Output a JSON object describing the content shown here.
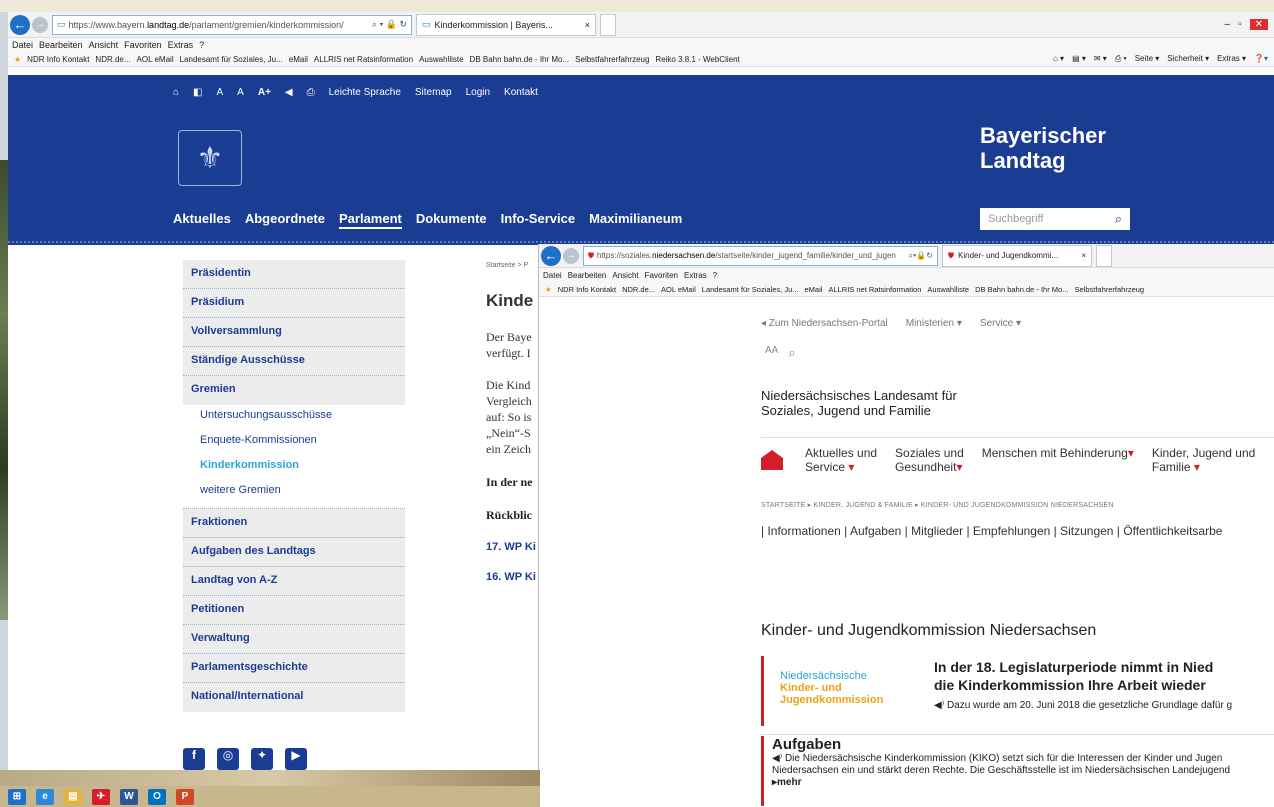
{
  "w1": {
    "url_prefix": "https://www.bayern.",
    "url_domain": "landtag.de",
    "url_path": "/parlament/gremien/kinderkommission/",
    "tab_title": "Kinderkommission | Bayeris...",
    "menu": [
      "Datei",
      "Bearbeiten",
      "Ansicht",
      "Favoriten",
      "Extras",
      "?"
    ],
    "favorites": [
      "NDR Info Kontakt",
      "NDR.de...",
      "AOL eMail",
      "Landesamt für Soziales, Ju...",
      "eMail",
      "ALLRIS net Ratsinformation",
      "Auswahlliste",
      "DB Bahn bahn.de - Ihr Mo...",
      "Selbstfahrerfahrzeug",
      "Reiko 3.8.1 - WebClient"
    ],
    "cmdbar": [
      "Seite ▾",
      "Sicherheit ▾",
      "Extras ▾"
    ],
    "util_nav": [
      "A",
      "A",
      "A+",
      "Leichte Sprache",
      "Sitemap",
      "Login",
      "Kontakt"
    ],
    "logo_line1": "Bayerischer",
    "logo_line2": "Landtag",
    "main_nav": [
      "Aktuelles",
      "Abgeordnete",
      "Parlament",
      "Dokumente",
      "Info-Service",
      "Maximilianeum"
    ],
    "search_placeholder": "Suchbegriff",
    "sidebar": {
      "items_top": [
        "Präsidentin",
        "Präsidium",
        "Vollversammlung",
        "Ständige Ausschüsse",
        "Gremien"
      ],
      "sub_items": [
        "Untersuchungsausschüsse",
        "Enquete-Kommissionen",
        "Kinderkommission",
        "weitere Gremien"
      ],
      "items_bottom": [
        "Fraktionen",
        "Aufgaben des Landtags",
        "Landtag von A-Z",
        "Petitionen",
        "Verwaltung",
        "Parlamentsgeschichte",
        "National/International"
      ]
    },
    "breadcrumb": "Startseite  >  P",
    "heading": "Kinde",
    "para1a": "Der Baye",
    "para1b": "verfügt. I",
    "para2": [
      "Die Kind",
      "Vergleich",
      "auf: So is",
      "„Nein“-S",
      "ein Zeich"
    ],
    "bold1": "In der ne",
    "bold2": "Rückblic",
    "link1": "17. WP Ki",
    "link2": "16. WP Ki"
  },
  "w2": {
    "url_prefix": "https://soziales.",
    "url_domain": "niedersachsen.de",
    "url_path": "/startseite/kinder_jugend_familie/kinder_und_jugen",
    "tab_title": "Kinder- und Jugendkommi...",
    "menu": [
      "Datei",
      "Bearbeiten",
      "Ansicht",
      "Favoriten",
      "Extras",
      "?"
    ],
    "favorites": [
      "NDR Info Kontakt",
      "NDR.de...",
      "AOL eMail",
      "Landesamt für Soziales, Ju...",
      "eMail",
      "ALLRIS net Ratsinformation",
      "Auswahlliste",
      "DB Bahn bahn.de - Ihr Mo...",
      "Selbstfahrerfahrzeug"
    ],
    "top_links": [
      "◂  Zum Niedersachsen-Portal",
      "Ministerien ▾",
      "Service ▾"
    ],
    "aa": "AA",
    "title_line1": "Niedersächsisches Landesamt für",
    "title_line2": "Soziales, Jugend und Familie",
    "nav": [
      {
        "l1": "Aktuelles und",
        "l2": "Service"
      },
      {
        "l1": "Soziales und",
        "l2": "Gesundheit"
      },
      {
        "l1": "Menschen mit Behinderung",
        "l2": ""
      },
      {
        "l1": "Kinder, Jugend und",
        "l2": "Familie"
      }
    ],
    "breadcrumb": "STARTSEITE   ▸ KINDER, JUGEND & FAMILIE   ▸ KINDER- UND JUGENDKOMMISSION NIEDERSACHSEN",
    "subnav": "|  Informationen  |  Aufgaben  |  Mitglieder  |  Empfehlungen  |  Sitzungen  |  Öffentlichkeitsarbe",
    "page_heading": "Kinder- und Jugendkommission Niedersachsen",
    "logo_line1": "Niedersächsische",
    "logo_line2": "Kinder- und",
    "logo_line3": "Jugendkommission",
    "news_title1": "In der 18. Legislaturperiode nimmt in Nied",
    "news_title2": "die Kinderkommission Ihre Arbeit wieder",
    "news_text": "Dazu wurde am 20. Juni 2018 die gesetzliche Grundlage dafür g",
    "aufgaben_title": "Aufgaben",
    "aufgaben_text1": "Die Niedersächsische Kinderkommission (KIKO) setzt sich für die Interessen der Kinder und Jugen",
    "aufgaben_text2": "Niedersachsen ein und stärkt deren Rechte. Die Geschäftsstelle ist im Niedersächsischen Landejugend",
    "mehr": "▸mehr"
  },
  "colors": {
    "bayern_blue": "#1b3c93",
    "ns_red": "#d41e2c",
    "active_link": "#2aa5d9"
  }
}
